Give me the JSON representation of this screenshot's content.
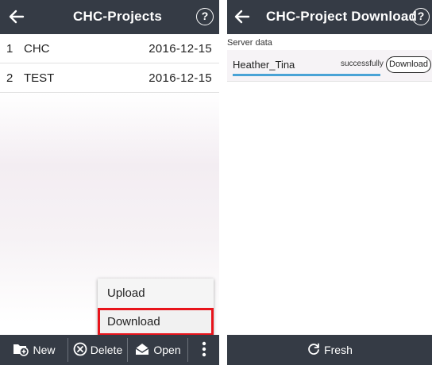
{
  "left_screen": {
    "header": {
      "title": "CHC-Projects",
      "back_icon": "arrow-left-icon",
      "help_label": "?"
    },
    "projects": [
      {
        "index": "1",
        "name": "CHC",
        "date": "2016-12-15"
      },
      {
        "index": "2",
        "name": "TEST",
        "date": "2016-12-15"
      }
    ],
    "popup_menu": {
      "upload_label": "Upload",
      "download_label": "Download",
      "highlighted": "Download"
    },
    "toolbar": {
      "new_label": "New",
      "delete_label": "Delete",
      "open_label": "Open",
      "more_icon": "more-vertical-icon"
    }
  },
  "right_screen": {
    "header": {
      "title": "CHC-Project Download",
      "back_icon": "arrow-left-icon",
      "help_label": "?"
    },
    "section_label": "Server data",
    "server_items": [
      {
        "name": "Heather_Tina",
        "status": "successfully",
        "button_label": "Download",
        "progress": 1.0
      }
    ],
    "toolbar": {
      "fresh_label": "Fresh",
      "fresh_icon": "refresh-icon"
    }
  },
  "colors": {
    "bar": "#353b45",
    "highlight": "#e8141b",
    "progress": "#49a3d6"
  }
}
